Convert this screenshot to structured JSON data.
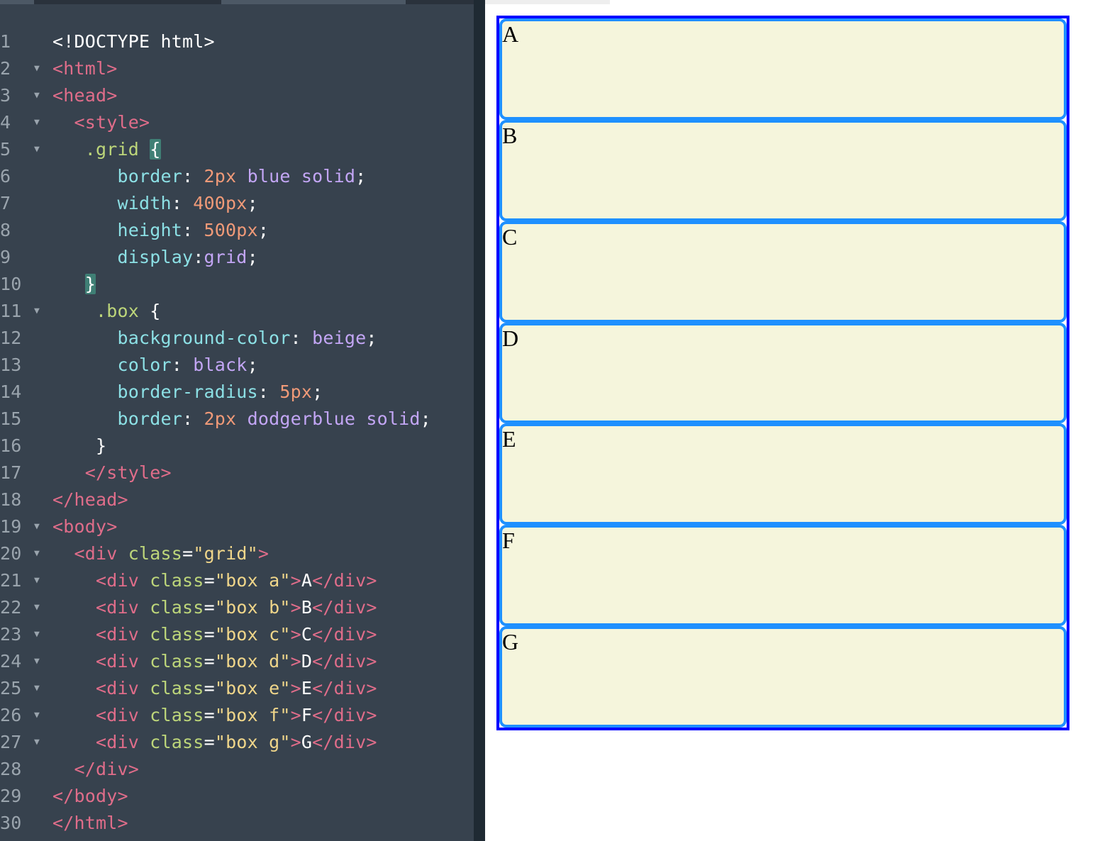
{
  "editor": {
    "lines": [
      {
        "n": "1",
        "fold": false,
        "tokens": [
          {
            "c": "t-pl",
            "t": "<!DOCTYPE html>"
          }
        ]
      },
      {
        "n": "2",
        "fold": true,
        "tokens": [
          {
            "c": "t-tag",
            "t": "<html>"
          }
        ]
      },
      {
        "n": "3",
        "fold": true,
        "tokens": [
          {
            "c": "t-tag",
            "t": "<head>"
          }
        ]
      },
      {
        "n": "4",
        "fold": true,
        "tokens": [
          {
            "c": "t-pl",
            "t": "  "
          },
          {
            "c": "t-tag",
            "t": "<style>"
          }
        ]
      },
      {
        "n": "5",
        "fold": true,
        "tokens": [
          {
            "c": "t-pl",
            "t": "   "
          },
          {
            "c": "t-sel",
            "t": ".grid"
          },
          {
            "c": "t-pl",
            "t": " "
          },
          {
            "c": "t-pl t-brace-hl",
            "t": "{"
          }
        ]
      },
      {
        "n": "6",
        "fold": false,
        "tokens": [
          {
            "c": "t-pl",
            "t": "      "
          },
          {
            "c": "t-prop",
            "t": "border"
          },
          {
            "c": "t-pl",
            "t": ": "
          },
          {
            "c": "t-num",
            "t": "2px"
          },
          {
            "c": "t-pl",
            "t": " "
          },
          {
            "c": "t-kw",
            "t": "blue"
          },
          {
            "c": "t-pl",
            "t": " "
          },
          {
            "c": "t-kw",
            "t": "solid"
          },
          {
            "c": "t-pl",
            "t": ";"
          }
        ]
      },
      {
        "n": "7",
        "fold": false,
        "tokens": [
          {
            "c": "t-pl",
            "t": "      "
          },
          {
            "c": "t-prop",
            "t": "width"
          },
          {
            "c": "t-pl",
            "t": ": "
          },
          {
            "c": "t-num",
            "t": "400px"
          },
          {
            "c": "t-pl",
            "t": ";"
          }
        ]
      },
      {
        "n": "8",
        "fold": false,
        "tokens": [
          {
            "c": "t-pl",
            "t": "      "
          },
          {
            "c": "t-prop",
            "t": "height"
          },
          {
            "c": "t-pl",
            "t": ": "
          },
          {
            "c": "t-num",
            "t": "500px"
          },
          {
            "c": "t-pl",
            "t": ";"
          }
        ]
      },
      {
        "n": "9",
        "fold": false,
        "tokens": [
          {
            "c": "t-pl",
            "t": "      "
          },
          {
            "c": "t-prop",
            "t": "display"
          },
          {
            "c": "t-pl",
            "t": ":"
          },
          {
            "c": "t-kw",
            "t": "grid"
          },
          {
            "c": "t-pl",
            "t": ";"
          }
        ]
      },
      {
        "n": "10",
        "fold": false,
        "tokens": [
          {
            "c": "t-pl",
            "t": "   "
          },
          {
            "c": "t-pl t-brace-hl",
            "t": "}"
          }
        ]
      },
      {
        "n": "11",
        "fold": true,
        "tokens": [
          {
            "c": "t-pl",
            "t": "    "
          },
          {
            "c": "t-sel",
            "t": ".box"
          },
          {
            "c": "t-pl",
            "t": " {"
          }
        ]
      },
      {
        "n": "12",
        "fold": false,
        "tokens": [
          {
            "c": "t-pl",
            "t": "      "
          },
          {
            "c": "t-prop",
            "t": "background-color"
          },
          {
            "c": "t-pl",
            "t": ": "
          },
          {
            "c": "t-kw",
            "t": "beige"
          },
          {
            "c": "t-pl",
            "t": ";"
          }
        ]
      },
      {
        "n": "13",
        "fold": false,
        "tokens": [
          {
            "c": "t-pl",
            "t": "      "
          },
          {
            "c": "t-prop",
            "t": "color"
          },
          {
            "c": "t-pl",
            "t": ": "
          },
          {
            "c": "t-kw",
            "t": "black"
          },
          {
            "c": "t-pl",
            "t": ";"
          }
        ]
      },
      {
        "n": "14",
        "fold": false,
        "tokens": [
          {
            "c": "t-pl",
            "t": "      "
          },
          {
            "c": "t-prop",
            "t": "border-radius"
          },
          {
            "c": "t-pl",
            "t": ": "
          },
          {
            "c": "t-num",
            "t": "5px"
          },
          {
            "c": "t-pl",
            "t": ";"
          }
        ]
      },
      {
        "n": "15",
        "fold": false,
        "tokens": [
          {
            "c": "t-pl",
            "t": "      "
          },
          {
            "c": "t-prop",
            "t": "border"
          },
          {
            "c": "t-pl",
            "t": ": "
          },
          {
            "c": "t-num",
            "t": "2px"
          },
          {
            "c": "t-pl",
            "t": " "
          },
          {
            "c": "t-kw",
            "t": "dodgerblue"
          },
          {
            "c": "t-pl",
            "t": " "
          },
          {
            "c": "t-kw",
            "t": "solid"
          },
          {
            "c": "t-pl",
            "t": ";"
          }
        ]
      },
      {
        "n": "16",
        "fold": false,
        "tokens": [
          {
            "c": "t-pl",
            "t": "    }"
          }
        ]
      },
      {
        "n": "17",
        "fold": false,
        "tokens": [
          {
            "c": "t-pl",
            "t": "   "
          },
          {
            "c": "t-tag",
            "t": "</style>"
          }
        ]
      },
      {
        "n": "18",
        "fold": false,
        "tokens": [
          {
            "c": "t-tag",
            "t": "</head>"
          }
        ]
      },
      {
        "n": "19",
        "fold": true,
        "tokens": [
          {
            "c": "t-tag",
            "t": "<body>"
          }
        ]
      },
      {
        "n": "20",
        "fold": true,
        "tokens": [
          {
            "c": "t-pl",
            "t": "  "
          },
          {
            "c": "t-tag",
            "t": "<div"
          },
          {
            "c": "t-pl",
            "t": " "
          },
          {
            "c": "t-attr",
            "t": "class"
          },
          {
            "c": "t-pl",
            "t": "="
          },
          {
            "c": "t-str",
            "t": "\"grid\""
          },
          {
            "c": "t-tag",
            "t": ">"
          }
        ]
      },
      {
        "n": "21",
        "fold": true,
        "tokens": [
          {
            "c": "t-pl",
            "t": "    "
          },
          {
            "c": "t-tag",
            "t": "<div"
          },
          {
            "c": "t-pl",
            "t": " "
          },
          {
            "c": "t-attr",
            "t": "class"
          },
          {
            "c": "t-pl",
            "t": "="
          },
          {
            "c": "t-str",
            "t": "\"box a\""
          },
          {
            "c": "t-tag",
            "t": ">"
          },
          {
            "c": "t-pl",
            "t": "A"
          },
          {
            "c": "t-tag",
            "t": "</div>"
          }
        ]
      },
      {
        "n": "22",
        "fold": true,
        "tokens": [
          {
            "c": "t-pl",
            "t": "    "
          },
          {
            "c": "t-tag",
            "t": "<div"
          },
          {
            "c": "t-pl",
            "t": " "
          },
          {
            "c": "t-attr",
            "t": "class"
          },
          {
            "c": "t-pl",
            "t": "="
          },
          {
            "c": "t-str",
            "t": "\"box b\""
          },
          {
            "c": "t-tag",
            "t": ">"
          },
          {
            "c": "t-pl",
            "t": "B"
          },
          {
            "c": "t-tag",
            "t": "</div>"
          }
        ]
      },
      {
        "n": "23",
        "fold": true,
        "tokens": [
          {
            "c": "t-pl",
            "t": "    "
          },
          {
            "c": "t-tag",
            "t": "<div"
          },
          {
            "c": "t-pl",
            "t": " "
          },
          {
            "c": "t-attr",
            "t": "class"
          },
          {
            "c": "t-pl",
            "t": "="
          },
          {
            "c": "t-str",
            "t": "\"box c\""
          },
          {
            "c": "t-tag",
            "t": ">"
          },
          {
            "c": "t-pl",
            "t": "C"
          },
          {
            "c": "t-tag",
            "t": "</div>"
          }
        ]
      },
      {
        "n": "24",
        "fold": true,
        "tokens": [
          {
            "c": "t-pl",
            "t": "    "
          },
          {
            "c": "t-tag",
            "t": "<div"
          },
          {
            "c": "t-pl",
            "t": " "
          },
          {
            "c": "t-attr",
            "t": "class"
          },
          {
            "c": "t-pl",
            "t": "="
          },
          {
            "c": "t-str",
            "t": "\"box d\""
          },
          {
            "c": "t-tag",
            "t": ">"
          },
          {
            "c": "t-pl",
            "t": "D"
          },
          {
            "c": "t-tag",
            "t": "</div>"
          }
        ]
      },
      {
        "n": "25",
        "fold": true,
        "tokens": [
          {
            "c": "t-pl",
            "t": "    "
          },
          {
            "c": "t-tag",
            "t": "<div"
          },
          {
            "c": "t-pl",
            "t": " "
          },
          {
            "c": "t-attr",
            "t": "class"
          },
          {
            "c": "t-pl",
            "t": "="
          },
          {
            "c": "t-str",
            "t": "\"box e\""
          },
          {
            "c": "t-tag",
            "t": ">"
          },
          {
            "c": "t-pl",
            "t": "E"
          },
          {
            "c": "t-tag",
            "t": "</div>"
          }
        ]
      },
      {
        "n": "26",
        "fold": true,
        "tokens": [
          {
            "c": "t-pl",
            "t": "    "
          },
          {
            "c": "t-tag",
            "t": "<div"
          },
          {
            "c": "t-pl",
            "t": " "
          },
          {
            "c": "t-attr",
            "t": "class"
          },
          {
            "c": "t-pl",
            "t": "="
          },
          {
            "c": "t-str",
            "t": "\"box f\""
          },
          {
            "c": "t-tag",
            "t": ">"
          },
          {
            "c": "t-pl",
            "t": "F"
          },
          {
            "c": "t-tag",
            "t": "</div>"
          }
        ]
      },
      {
        "n": "27",
        "fold": true,
        "tokens": [
          {
            "c": "t-pl",
            "t": "    "
          },
          {
            "c": "t-tag",
            "t": "<div"
          },
          {
            "c": "t-pl",
            "t": " "
          },
          {
            "c": "t-attr",
            "t": "class"
          },
          {
            "c": "t-pl",
            "t": "="
          },
          {
            "c": "t-str",
            "t": "\"box g\""
          },
          {
            "c": "t-tag",
            "t": ">"
          },
          {
            "c": "t-pl",
            "t": "G"
          },
          {
            "c": "t-tag",
            "t": "</div>"
          }
        ]
      },
      {
        "n": "28",
        "fold": false,
        "tokens": [
          {
            "c": "t-pl",
            "t": "  "
          },
          {
            "c": "t-tag",
            "t": "</div>"
          }
        ]
      },
      {
        "n": "29",
        "fold": false,
        "tokens": [
          {
            "c": "t-tag",
            "t": "</body>"
          }
        ]
      },
      {
        "n": "30",
        "fold": false,
        "tokens": [
          {
            "c": "t-tag",
            "t": "</html>"
          }
        ]
      }
    ],
    "fold_glyph": "▼",
    "colors": {
      "background": "#37424e",
      "tag": "#e06d8a",
      "selector": "#bdd67a",
      "property": "#8ce0e5",
      "number": "#f09a78",
      "keyword": "#c3a6f5",
      "string": "#f0d68a"
    }
  },
  "preview": {
    "boxes": [
      {
        "id": "a",
        "label": "A"
      },
      {
        "id": "b",
        "label": "B"
      },
      {
        "id": "c",
        "label": "C"
      },
      {
        "id": "d",
        "label": "D"
      },
      {
        "id": "e",
        "label": "E"
      },
      {
        "id": "f",
        "label": "F"
      },
      {
        "id": "g",
        "label": "G"
      }
    ],
    "colors": {
      "grid_border": "#0000ff",
      "box_background": "#f5f5dc",
      "box_border": "#1e90ff",
      "box_text": "#000000"
    }
  }
}
